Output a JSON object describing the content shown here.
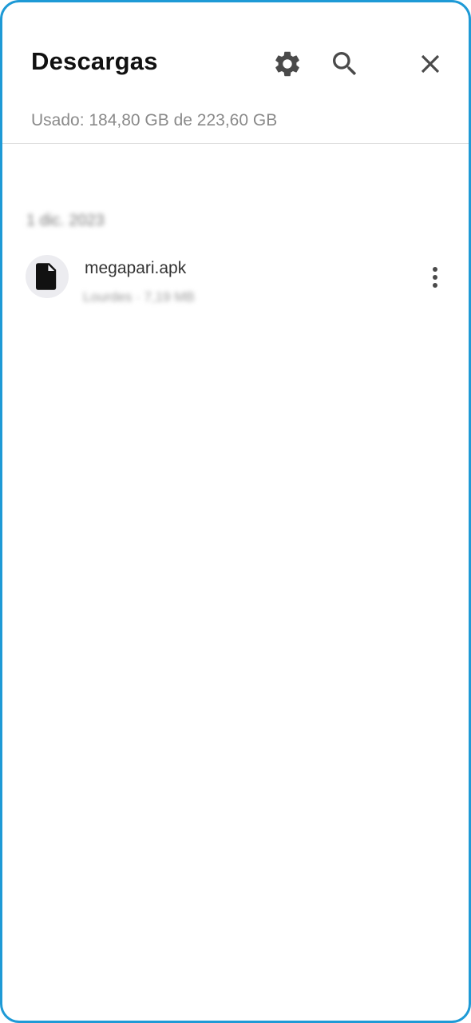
{
  "header": {
    "title": "Descargas",
    "usage": "Usado: 184,80 GB de 223,60 GB",
    "icons": [
      "gear-icon",
      "search-icon",
      "close-icon"
    ]
  },
  "section": {
    "date_label": "1 dic. 2023"
  },
  "files": [
    {
      "name": "megapari.apk",
      "meta": "Lourdes · 7,19 MB",
      "icon": "file-icon",
      "menu_icon": "more-vert-icon"
    }
  ],
  "colors": {
    "frame_border": "#1e9ad6",
    "title": "#111111",
    "icon": "#4a4a4a",
    "secondary_text": "#8a8a8a",
    "file_avatar_bg": "#ececf0"
  }
}
